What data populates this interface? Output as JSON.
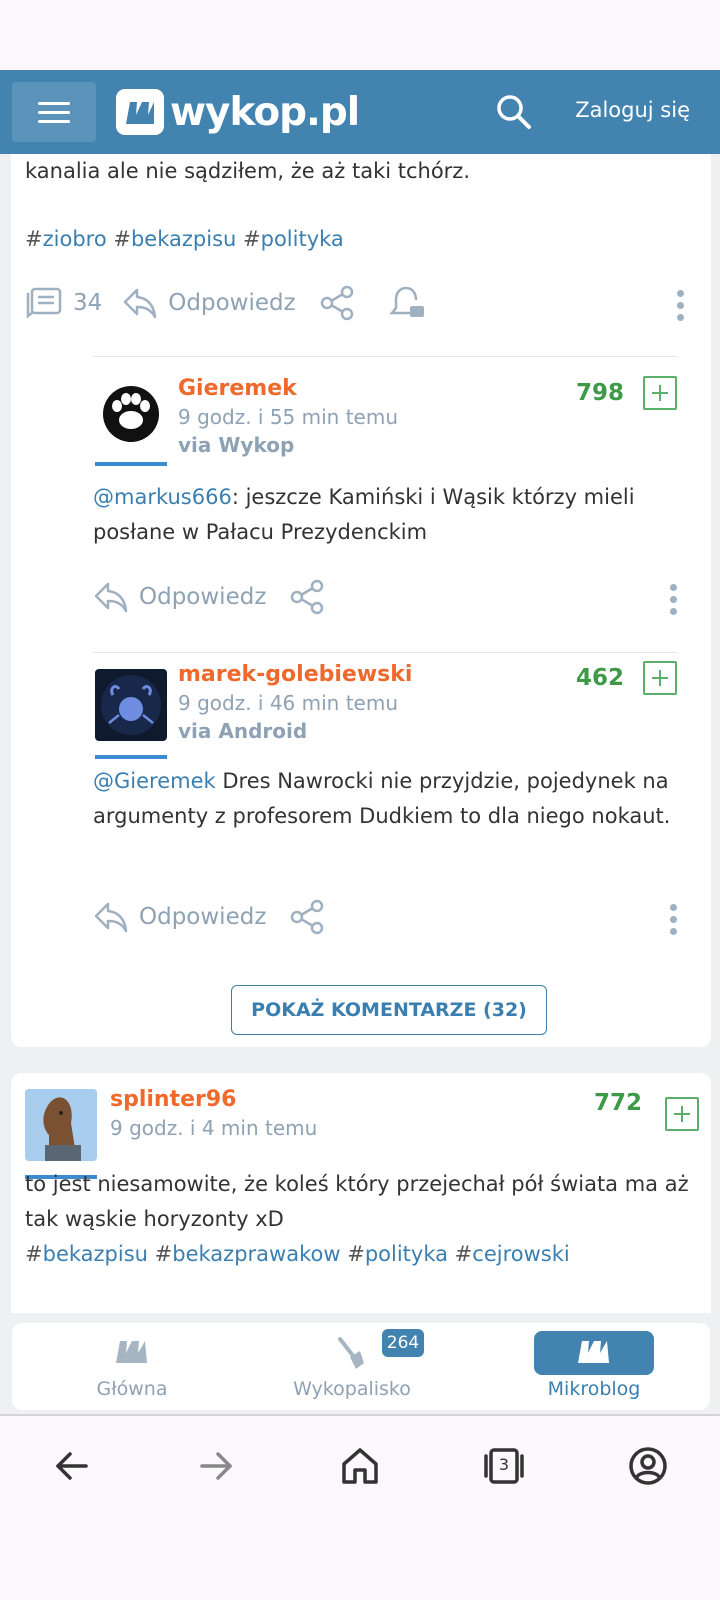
{
  "header": {
    "logo_text": "wykop.pl",
    "login_label": "Zaloguj się"
  },
  "post1": {
    "text_tail": "kanalia ale nie sądziłem, że aż taki tchórz.",
    "tags": [
      "ziobro",
      "bekazpisu",
      "polityka"
    ],
    "comment_count": "34",
    "reply_label": "Odpowiedz"
  },
  "comments": [
    {
      "username": "Gieremek",
      "time": "9 godz. i 55 min temu",
      "via": "via Wykop",
      "score": "798",
      "mention": "@markus666",
      "text": ": jeszcze Kamiński i Wąsik którzy mieli posłane w Pałacu Prezydenckim",
      "reply_label": "Odpowiedz"
    },
    {
      "username": "marek-golebiewski",
      "time": "9 godz. i 46 min temu",
      "via": "via Android",
      "score": "462",
      "mention": "@Gieremek",
      "text": " Dres Nawrocki nie przyjdzie, pojedynek na argumenty z profesorem Dudkiem to dla niego nokaut.",
      "reply_label": "Odpowiedz"
    }
  ],
  "show_comments_label": "POKAŻ KOMENTARZE (32)",
  "post2": {
    "username": "splinter96",
    "time": "9 godz. i 4 min temu",
    "score": "772",
    "text": "to jest niesamowite, że koleś który przejechał pół świata ma aż tak wąskie horyzonty xD",
    "tags": [
      "bekazpisu",
      "bekazprawakow",
      "polityka",
      "cejrowski"
    ]
  },
  "bottom_nav": {
    "items": [
      {
        "label": "Główna",
        "icon": "home-logo-icon"
      },
      {
        "label": "Wykopalisko",
        "icon": "shovel-icon",
        "badge": "264"
      },
      {
        "label": "Mikroblog",
        "icon": "mikroblog-logo-icon",
        "active": true
      }
    ]
  },
  "browser": {
    "tab_count": "3"
  },
  "colors": {
    "brand": "#4383af",
    "username": "#f0692c",
    "score": "#3e9a47",
    "tag": "#3a7fb0"
  }
}
